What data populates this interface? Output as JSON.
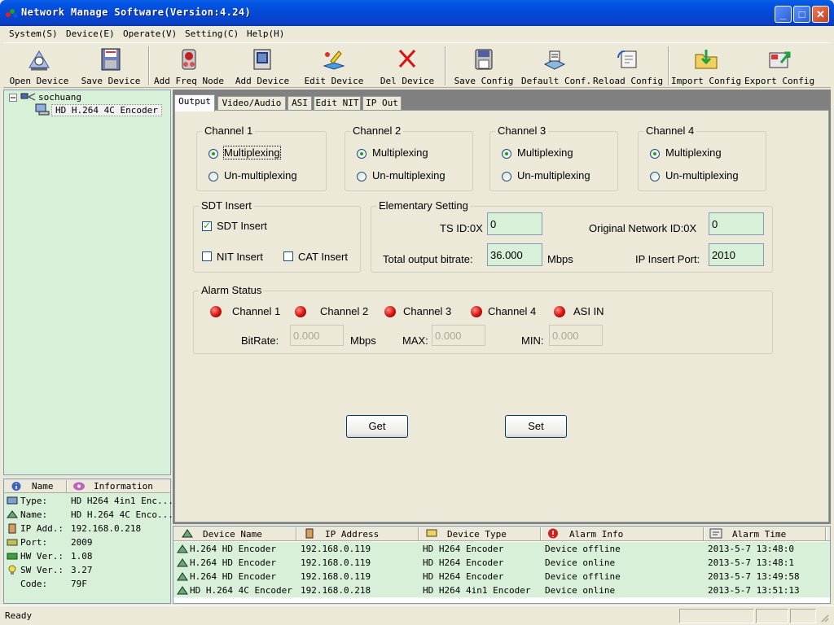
{
  "window": {
    "title": "Network Manage Software(Version:4.24)",
    "buttons": {
      "minimize": "_",
      "maximize": "□",
      "close": "✕"
    }
  },
  "menu": [
    "System(S)",
    "Device(E)",
    "Operate(V)",
    "Setting(C)",
    "Help(H)"
  ],
  "toolbar": [
    {
      "label": "Open Device",
      "icon": "open-device-icon"
    },
    {
      "label": "Save Device",
      "icon": "save-device-icon"
    },
    {
      "label": "Add Freq Node",
      "icon": "add-freq-node-icon"
    },
    {
      "label": "Add Device",
      "icon": "add-device-icon"
    },
    {
      "label": "Edit Device",
      "icon": "edit-device-icon"
    },
    {
      "label": "Del Device",
      "icon": "delete-icon"
    },
    {
      "label": "Save Config",
      "icon": "save-config-icon"
    },
    {
      "label": "Default Conf.",
      "icon": "default-config-icon"
    },
    {
      "label": "Reload Config",
      "icon": "reload-config-icon"
    },
    {
      "label": "Import Config",
      "icon": "import-config-icon"
    },
    {
      "label": "Export Config",
      "icon": "export-config-icon"
    }
  ],
  "tree": {
    "root": "sochuang",
    "child": "HD H.264 4C Encoder"
  },
  "info": {
    "headers": {
      "name": "Name",
      "information": "Information"
    },
    "rows": [
      {
        "key": "Type:",
        "value": "HD H264 4in1 Enc..."
      },
      {
        "key": "Name:",
        "value": "HD H.264 4C Enco..."
      },
      {
        "key": "IP Add.:",
        "value": "192.168.0.218"
      },
      {
        "key": "Port:",
        "value": "2009"
      },
      {
        "key": "HW Ver.:",
        "value": "1.08"
      },
      {
        "key": "SW Ver.:",
        "value": "3.27"
      },
      {
        "key": "Code:",
        "value": "79F"
      }
    ]
  },
  "tabs": [
    "Output",
    "Video/Audio",
    "ASI",
    "Edit NIT",
    "IP Out"
  ],
  "active_tab": "Output",
  "channels": [
    {
      "title": "Channel 1",
      "opt1": "Multiplexing",
      "opt2": "Un-multiplexing",
      "selected": "Multiplexing"
    },
    {
      "title": "Channel 2",
      "opt1": "Multiplexing",
      "opt2": "Un-multiplexing",
      "selected": "Multiplexing"
    },
    {
      "title": "Channel 3",
      "opt1": "Multiplexing",
      "opt2": "Un-multiplexing",
      "selected": "Multiplexing"
    },
    {
      "title": "Channel 4",
      "opt1": "Multiplexing",
      "opt2": "Un-multiplexing",
      "selected": "Multiplexing"
    }
  ],
  "sdt": {
    "title": "SDT Insert",
    "sdt_label": "SDT Insert",
    "sdt_checked": true,
    "nit_label": "NIT Insert",
    "nit_checked": false,
    "cat_label": "CAT Insert",
    "cat_checked": false
  },
  "elementary": {
    "title": "Elementary Setting",
    "ts_id_label": "TS ID:0X",
    "ts_id": "0",
    "onid_label": "Original Network ID:0X",
    "onid": "0",
    "bitrate_label": "Total output bitrate:",
    "bitrate": "36.000",
    "bitrate_unit": "Mbps",
    "port_label": "IP Insert Port:",
    "port": "2010"
  },
  "alarm": {
    "title": "Alarm Status",
    "indicators": [
      "Channel 1",
      "Channel 2",
      "Channel 3",
      "Channel 4",
      "ASI IN"
    ],
    "led_color": "#d01010",
    "bitrate_label": "BitRate:",
    "bitrate": "0.000",
    "unit": "Mbps",
    "max_label": "MAX:",
    "max": "0.000",
    "min_label": "MIN:",
    "min": "0.000"
  },
  "actions": {
    "get": "Get",
    "set": "Set"
  },
  "devices": {
    "headers": [
      "Device Name",
      "IP Address",
      "Device Type",
      "Alarm Info",
      "Alarm Time"
    ],
    "rows": [
      {
        "name": "H.264 HD Encoder",
        "ip": "192.168.0.119",
        "type": "HD H264 Encoder",
        "alarm": "Device offline",
        "time": "2013-5-7 13:48:0"
      },
      {
        "name": "H.264 HD Encoder",
        "ip": "192.168.0.119",
        "type": "HD H264 Encoder",
        "alarm": "Device online",
        "time": "2013-5-7 13:48:1"
      },
      {
        "name": "H.264 HD Encoder",
        "ip": "192.168.0.119",
        "type": "HD H264 Encoder",
        "alarm": "Device offline",
        "time": "2013-5-7 13:49:58"
      },
      {
        "name": "HD H.264 4C Encoder",
        "ip": "192.168.0.218",
        "type": "HD H264 4in1 Encoder",
        "alarm": "Device online",
        "time": "2013-5-7 13:51:13"
      }
    ]
  },
  "status": {
    "text": "Ready"
  },
  "colors": {
    "panel_green": "#d8f0d8",
    "title_blue": "#0052e0",
    "main_gray": "#808080"
  }
}
